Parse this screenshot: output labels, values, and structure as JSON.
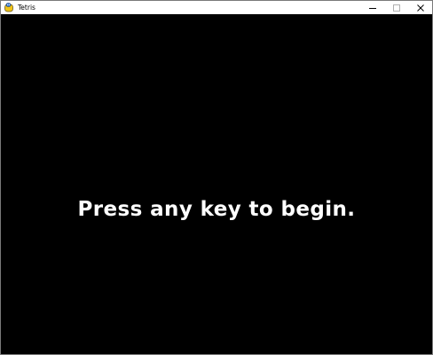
{
  "window": {
    "title": "Tetris",
    "app_icon": "pygame-snake-icon",
    "controls": {
      "minimize_icon": "minimize-icon",
      "maximize_icon": "maximize-icon",
      "close_icon": "close-icon"
    }
  },
  "game": {
    "prompt": "Press any key to begin."
  },
  "colors": {
    "background": "#000000",
    "text": "#ffffff"
  }
}
